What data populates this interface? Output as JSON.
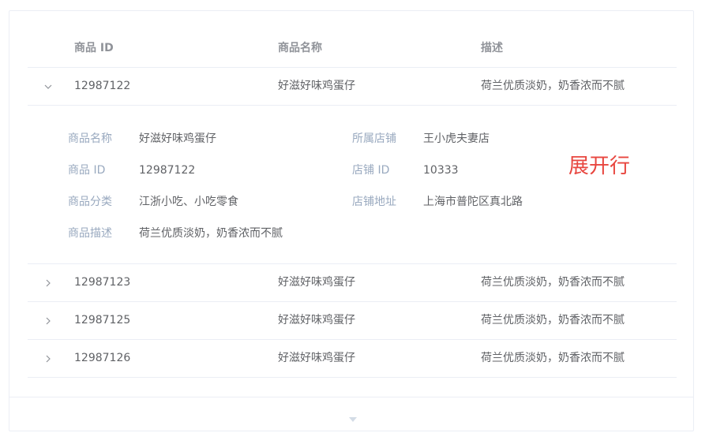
{
  "table": {
    "headers": {
      "id": "商品 ID",
      "name": "商品名称",
      "desc": "描述"
    },
    "rows": [
      {
        "id": "12987122",
        "name": "好滋好味鸡蛋仔",
        "desc": "荷兰优质淡奶，奶香浓而不腻",
        "expanded": true
      },
      {
        "id": "12987123",
        "name": "好滋好味鸡蛋仔",
        "desc": "荷兰优质淡奶，奶香浓而不腻",
        "expanded": false
      },
      {
        "id": "12987125",
        "name": "好滋好味鸡蛋仔",
        "desc": "荷兰优质淡奶，奶香浓而不腻",
        "expanded": false
      },
      {
        "id": "12987126",
        "name": "好滋好味鸡蛋仔",
        "desc": "荷兰优质淡奶，奶香浓而不腻",
        "expanded": false
      }
    ],
    "detail": {
      "product_name": {
        "label": "商品名称",
        "value": "好滋好味鸡蛋仔"
      },
      "shop": {
        "label": "所属店铺",
        "value": "王小虎夫妻店"
      },
      "product_id": {
        "label": "商品 ID",
        "value": "12987122"
      },
      "shop_id": {
        "label": "店铺 ID",
        "value": "10333"
      },
      "category": {
        "label": "商品分类",
        "value": "江浙小吃、小吃零食"
      },
      "shop_address": {
        "label": "店铺地址",
        "value": "上海市普陀区真北路"
      },
      "description": {
        "label": "商品描述",
        "value": "荷兰优质淡奶，奶香浓而不腻"
      }
    }
  },
  "annotation": "展开行",
  "icons": {
    "expanded": "chevron-down-icon",
    "collapsed": "chevron-right-icon",
    "more": "triangle-down-icon"
  },
  "colors": {
    "border": "#ebeef5",
    "header_text": "#909399",
    "label_text": "#99a9bf",
    "body_text": "#606266",
    "annotation": "#e8463f"
  }
}
